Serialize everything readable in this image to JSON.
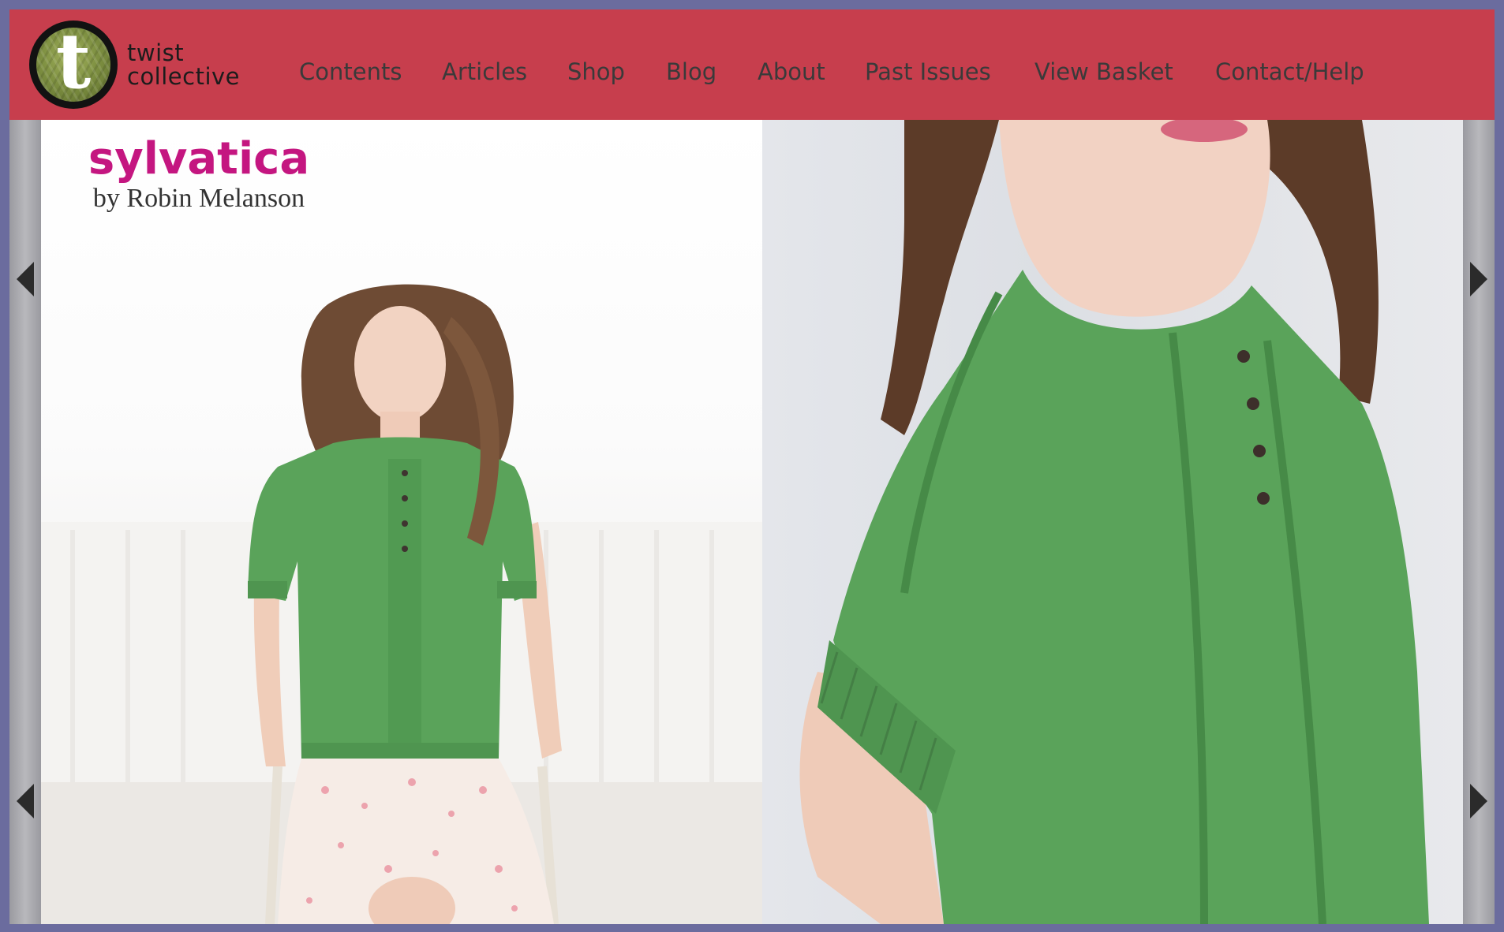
{
  "header": {
    "logo": {
      "letter": "t",
      "line1": "twist",
      "line2": "collective"
    },
    "nav": [
      {
        "label": "Contents"
      },
      {
        "label": "Articles"
      },
      {
        "label": "Shop"
      },
      {
        "label": "Blog"
      },
      {
        "label": "About"
      },
      {
        "label": "Past Issues"
      },
      {
        "label": "View Basket"
      },
      {
        "label": "Contact/Help"
      }
    ]
  },
  "pattern": {
    "title": "sylvatica",
    "byline": "by Robin Melanson"
  },
  "gallery": {
    "left_photo": "model-seated-green-sweater",
    "right_photo": "sweater-sleeve-detail",
    "prev_icon": "chevron-left-icon",
    "next_icon": "chevron-right-icon"
  },
  "colors": {
    "header_bg": "#c73e4d",
    "page_border": "#6b6c9e",
    "title_magenta": "#c41680",
    "sweater_green": "#5aa35a"
  }
}
